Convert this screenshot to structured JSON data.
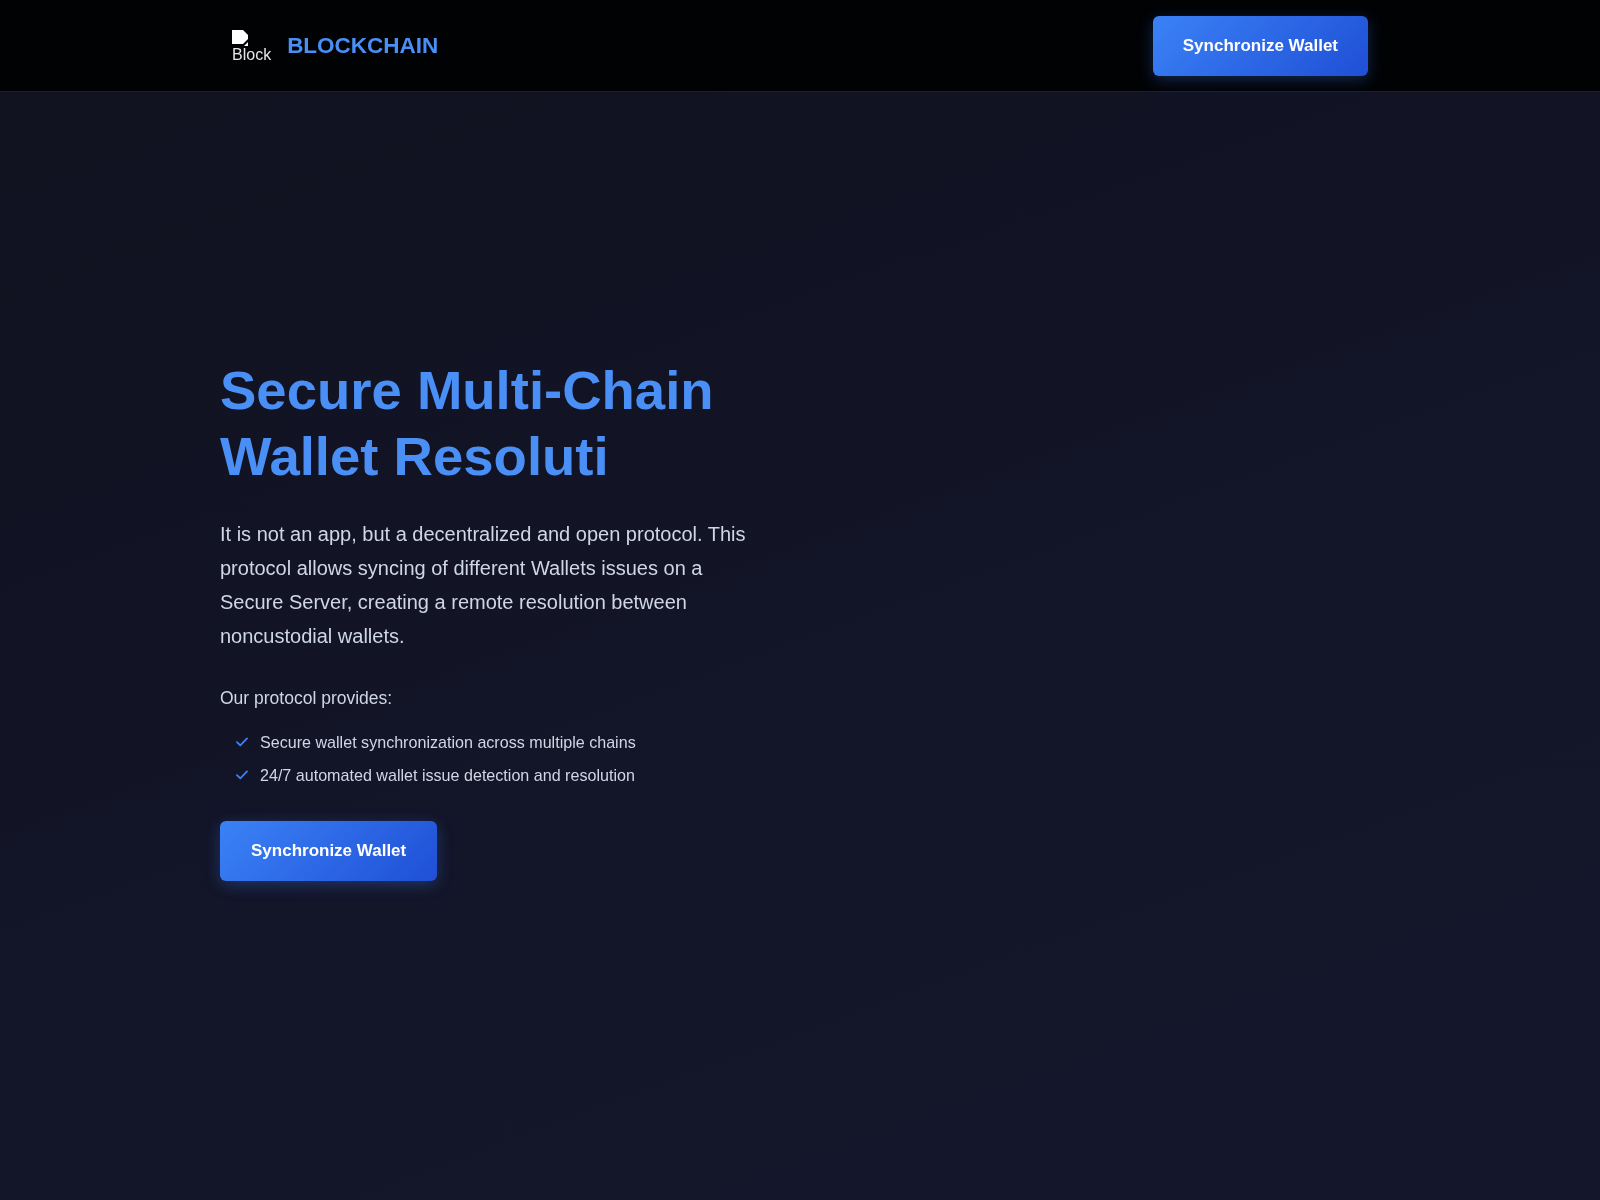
{
  "header": {
    "logo": {
      "alt_text": "Block"
    },
    "brand": "BLOCKCHAIN",
    "button": "Synchronize Wallet"
  },
  "hero": {
    "title": "Secure Multi-Chain Wallet Resoluti",
    "description": "It is not an app, but a decentralized and open protocol. This protocol allows syncing of different Wallets issues on a Secure Server, creating a remote resolution between noncustodial wallets.",
    "features_intro": "Our protocol provides:",
    "features": [
      "Secure wallet synchronization across multiple chains",
      "24/7 automated wallet issue detection and resolution"
    ],
    "button": "Synchronize Wallet"
  }
}
